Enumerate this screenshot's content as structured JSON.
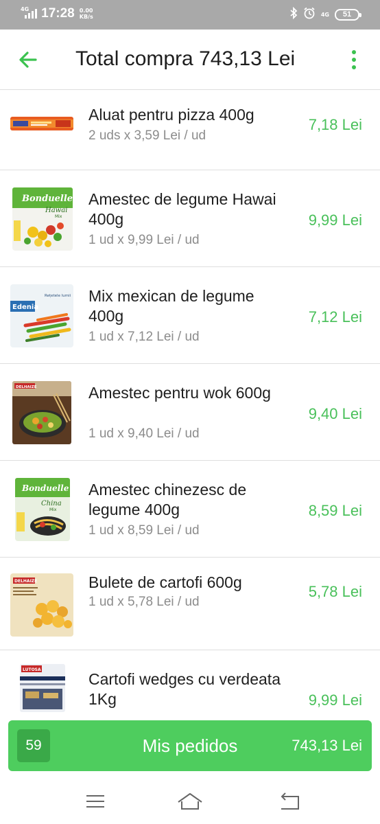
{
  "status_bar": {
    "network": "4G",
    "time": "17:28",
    "speed_value": "0.00",
    "speed_unit": "KB/s",
    "network_right": "4G",
    "battery": "51",
    "icons": [
      "bluetooth-icon",
      "alarm-icon",
      "signal-icon",
      "battery-icon"
    ]
  },
  "header": {
    "title": "Total compra 743,13 Lei",
    "back_icon": "arrow-left-icon",
    "menu_icon": "more-vert-icon",
    "accent": "#3bc24f"
  },
  "items": [
    {
      "name": "Aluat pentru pizza 400g",
      "qty": "2 uds x 3,59 Lei / ud",
      "price": "7,18 Lei",
      "image": "pizza-dough-package"
    },
    {
      "name": "Amestec de legume Hawai 400g",
      "qty": "1 ud x 9,99 Lei / ud",
      "price": "9,99 Lei",
      "image": "bonduelle-hawai-mix-package",
      "brand": "Bonduelle",
      "label": "Hawai",
      "sublabel": "Mix"
    },
    {
      "name": "Mix mexican de legume 400g",
      "qty": "1 ud x 7,12 Lei / ud",
      "price": "7,12 Lei",
      "image": "edenia-mexican-mix-package",
      "brand": "Edenia",
      "label": "Rețetele lumii"
    },
    {
      "name": "Amestec pentru wok 600g",
      "qty": "1 ud x 9,40 Lei / ud",
      "price": "9,40 Lei",
      "image": "delhaize-wok-mix-package",
      "brand": "DELHAIZE"
    },
    {
      "name": "Amestec chinezesc de legume 400g",
      "qty": "1 ud x 8,59 Lei / ud",
      "price": "8,59 Lei",
      "image": "bonduelle-china-mix-package",
      "brand": "Bonduelle",
      "label": "China",
      "sublabel": "Mix"
    },
    {
      "name": "Bulete de cartofi 600g",
      "qty": "1 ud x 5,78 Lei / ud",
      "price": "5,78 Lei",
      "image": "delhaize-potato-balls-package",
      "brand": "DELHAIZE"
    },
    {
      "name": "Cartofi wedges cu verdeata 1Kg",
      "qty": "",
      "price": "9,99 Lei",
      "image": "lutosa-wedges-package",
      "brand": "LUTOSA"
    }
  ],
  "order_bar": {
    "count": "59",
    "label": "Mis pedidos",
    "total": "743,13 Lei",
    "color": "#4ecd5e"
  },
  "nav_bar": {
    "icons": [
      "menu-icon",
      "home-icon",
      "back-icon"
    ]
  }
}
